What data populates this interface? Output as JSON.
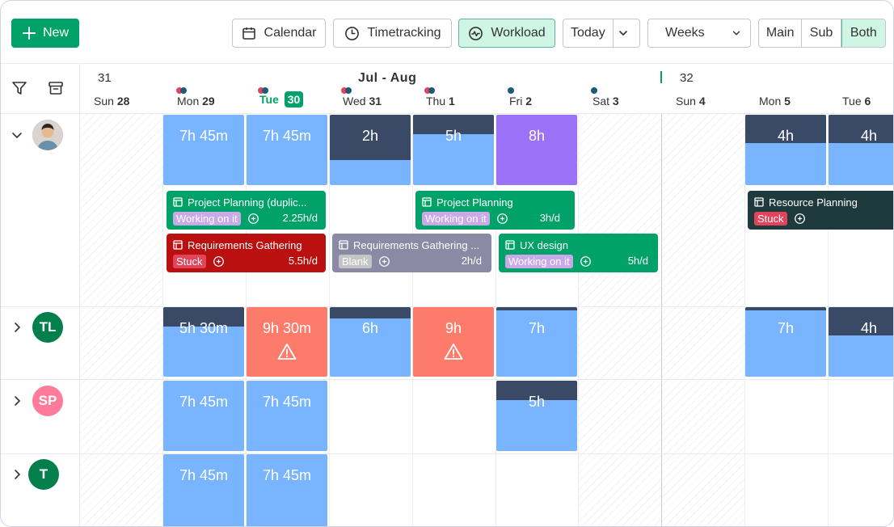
{
  "toolbar": {
    "new_label": "New",
    "calendar_label": "Calendar",
    "timetracking_label": "Timetracking",
    "workload_label": "Workload",
    "today_label": "Today",
    "range_label": "Weeks",
    "seg_main": "Main",
    "seg_sub": "Sub",
    "seg_both": "Both",
    "active_view": "Workload",
    "active_seg": "Both"
  },
  "header": {
    "week_left": "31",
    "week_right": "32",
    "month_range": "Jul  -  Aug",
    "days": [
      {
        "name": "Sun",
        "num": "28"
      },
      {
        "name": "Mon",
        "num": "29"
      },
      {
        "name": "Tue",
        "num": "30"
      },
      {
        "name": "Wed",
        "num": "31"
      },
      {
        "name": "Thu",
        "num": "1"
      },
      {
        "name": "Fri",
        "num": "2"
      },
      {
        "name": "Sat",
        "num": "3"
      },
      {
        "name": "Sun",
        "num": "4"
      },
      {
        "name": "Mon",
        "num": "5"
      },
      {
        "name": "Tue",
        "num": "6"
      }
    ],
    "today_index": 2
  },
  "rows": [
    {
      "avatar": "photo",
      "expanded": true,
      "cells": [
        {
          "label": "7h 45m"
        },
        {
          "label": "7h 45m"
        },
        {
          "label": "2h"
        },
        {
          "label": "5h"
        },
        {
          "label": "8h"
        },
        {
          "label": "4h"
        },
        {
          "label": "4h"
        }
      ],
      "tasks": [
        {
          "title": "Project Planning (duplic...",
          "status": "Working on it",
          "rate": "2.25h/d"
        },
        {
          "title": "Project Planning",
          "status": "Working on it",
          "rate": "3h/d"
        },
        {
          "title": "Resource Planning",
          "status": "Stuck",
          "rate": ""
        },
        {
          "title": "Requirements Gathering",
          "status": "Stuck",
          "rate": "5.5h/d"
        },
        {
          "title": "Requirements Gathering ...",
          "status": "Blank",
          "rate": "2h/d"
        },
        {
          "title": "UX design",
          "status": "Working on it",
          "rate": "5h/d"
        }
      ]
    },
    {
      "avatar": "TL",
      "expanded": false,
      "cells": [
        {
          "label": "5h 30m"
        },
        {
          "label": "9h 30m"
        },
        {
          "label": "6h"
        },
        {
          "label": "9h"
        },
        {
          "label": "7h"
        },
        {
          "label": "7h"
        },
        {
          "label": "4h"
        }
      ]
    },
    {
      "avatar": "SP",
      "expanded": false,
      "cells": [
        {
          "label": "7h 45m"
        },
        {
          "label": "7h 45m"
        },
        {
          "label": "5h"
        }
      ]
    },
    {
      "avatar": "T",
      "expanded": false,
      "cells": [
        {
          "label": "7h 45m"
        },
        {
          "label": "7h 45m"
        }
      ]
    }
  ],
  "colors": {
    "accent": "#00a26a",
    "capacity": "#78b4ff",
    "allocated": "#3a4a66",
    "overload": "#fd7b6a",
    "purple": "#9b71f8",
    "task_green": "#00a26a",
    "task_red": "#bb1010",
    "task_grey": "#8b8aa4",
    "task_dark": "#1f3a3d",
    "status_working": "#c9a9e8",
    "status_stuck": "#e2445c",
    "status_blank": "#c4c4c4"
  },
  "icons": [
    "plus-icon",
    "calendar-icon",
    "clock-icon",
    "workload-icon",
    "chevron-down-icon",
    "filter-icon",
    "archive-icon",
    "chevron-right-icon",
    "warning-icon",
    "task-icon",
    "add-update-icon"
  ]
}
